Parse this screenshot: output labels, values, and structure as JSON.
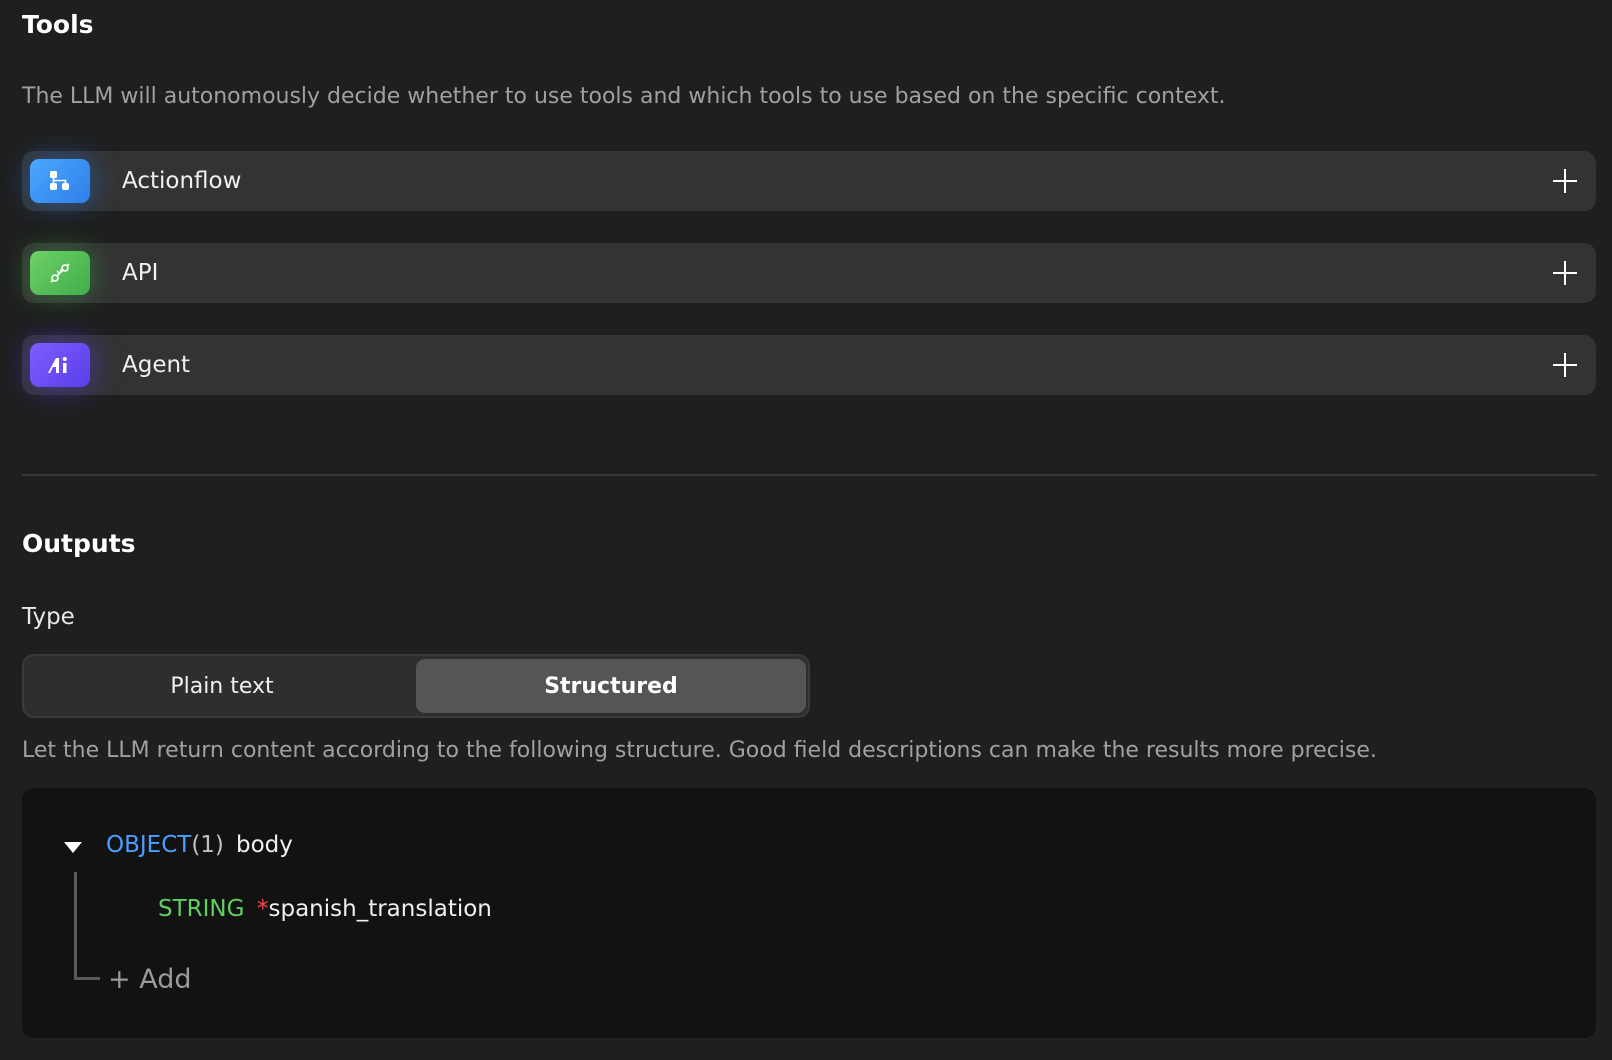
{
  "tools": {
    "title": "Tools",
    "description": "The LLM will autonomously decide whether to use tools and which tools to use based on the specific context.",
    "items": [
      {
        "label": "Actionflow",
        "icon": "actionflow-icon",
        "color": "#3b8ff0"
      },
      {
        "label": "API",
        "icon": "api-plug-icon",
        "color": "#4fbf55"
      },
      {
        "label": "Agent",
        "icon": "ai-agent-icon",
        "color": "#6a4cf5"
      }
    ]
  },
  "outputs": {
    "title": "Outputs",
    "type_label": "Type",
    "type_options": [
      "Plain text",
      "Structured"
    ],
    "selected_type": "Structured",
    "structure_description": "Let the LLM return content according to the following structure. Good field descriptions can make the results more precise.",
    "schema": {
      "root_type": "OBJECT",
      "root_count": "(1)",
      "root_name": "body",
      "fields": [
        {
          "type": "STRING",
          "required_marker": "*",
          "name": "spanish_translation"
        }
      ],
      "add_label": "+ Add"
    }
  }
}
